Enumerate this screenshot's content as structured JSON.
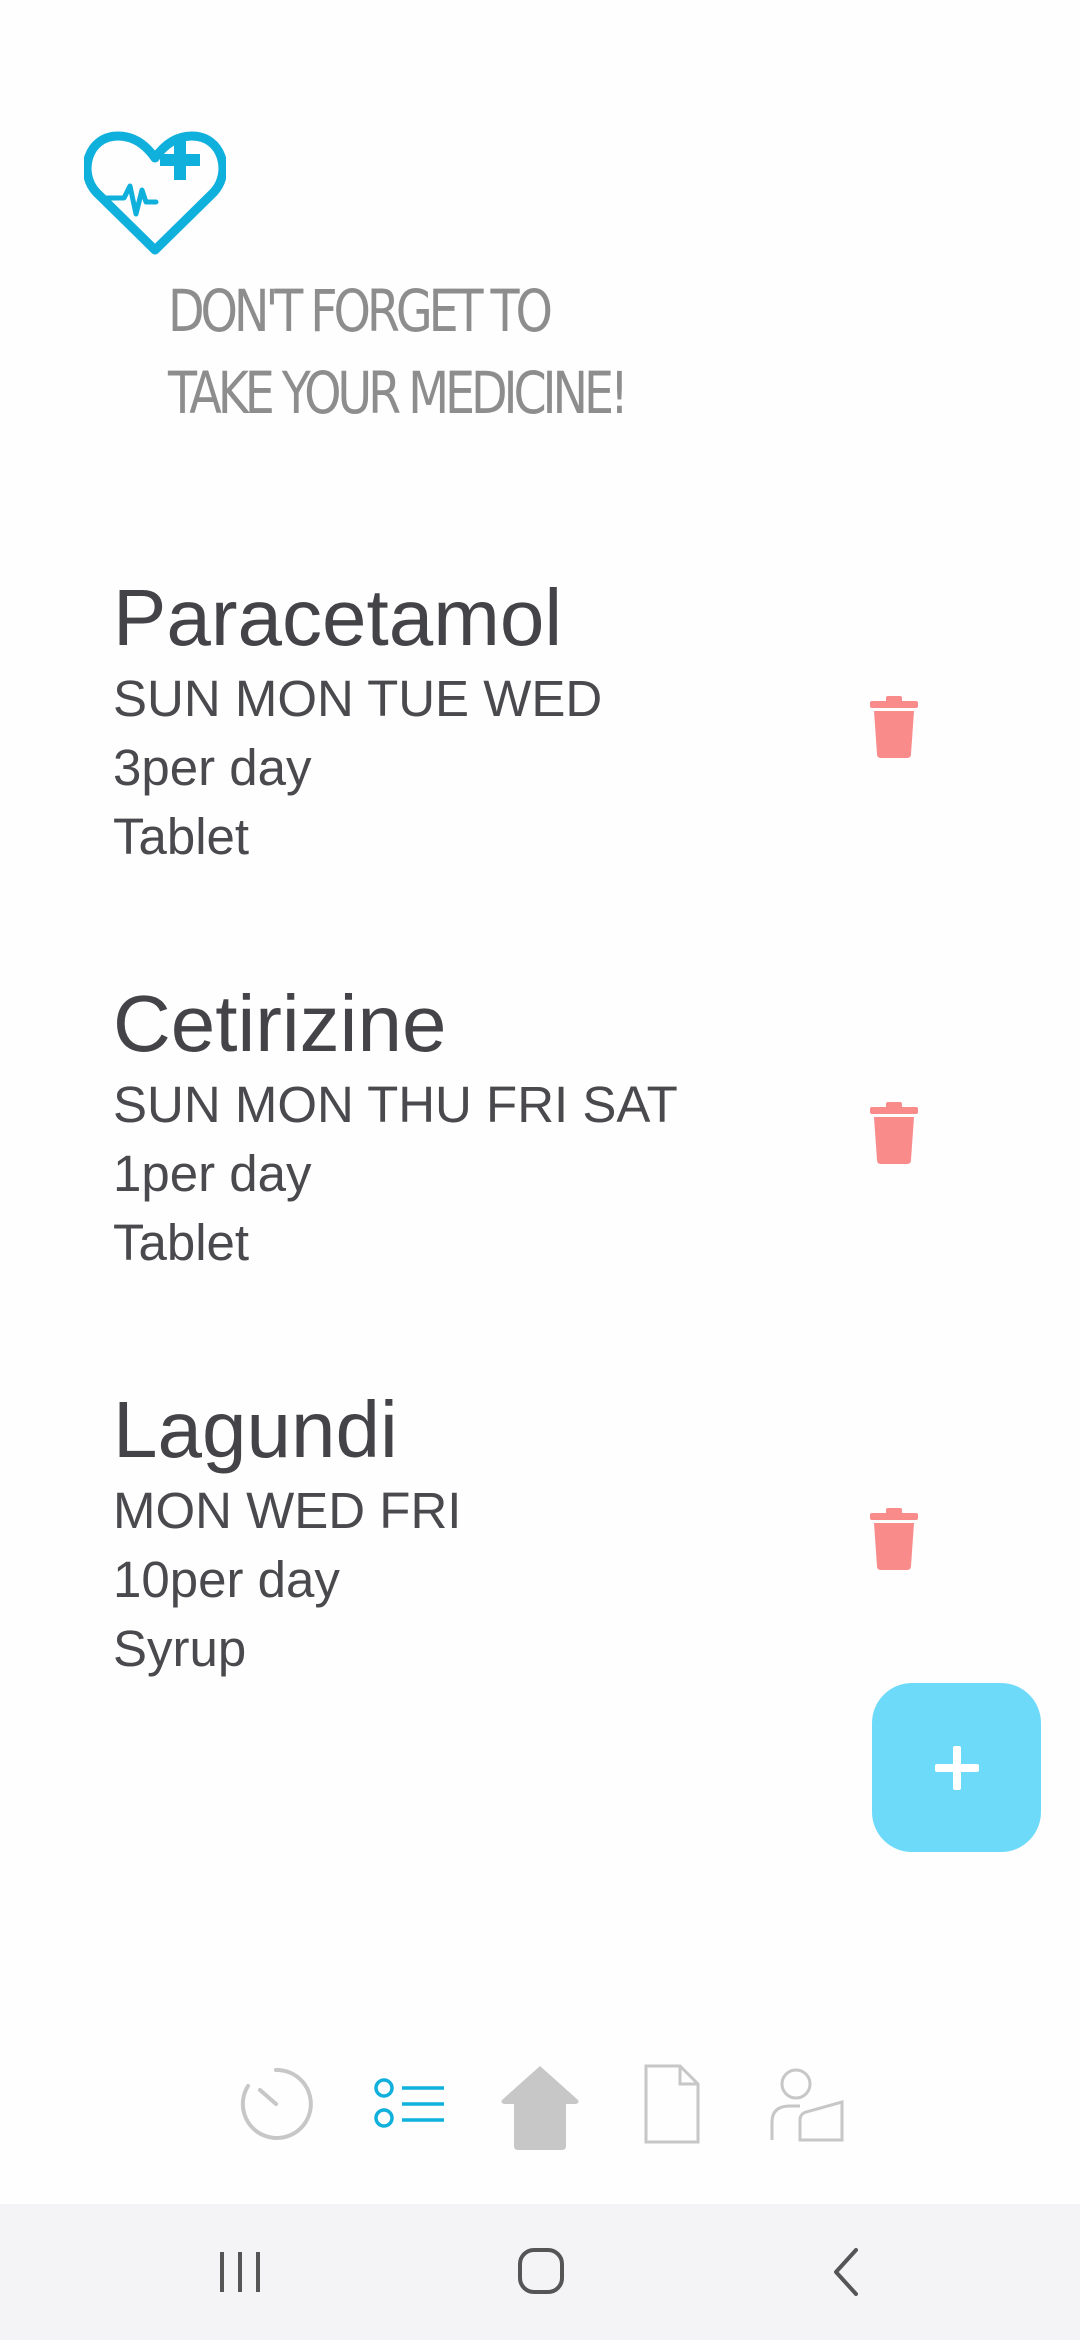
{
  "header": {
    "logo_icon": "heart-pulse-cross-icon",
    "headline_line1": "DON'T FORGET TO",
    "headline_line2": "TAKE YOUR MEDICINE!"
  },
  "medicines": [
    {
      "name": "Paracetamol",
      "days": "SUN MON TUE WED",
      "frequency": "3per day",
      "form": "Tablet"
    },
    {
      "name": "Cetirizine",
      "days": "SUN MON THU FRI SAT",
      "frequency": "1per day",
      "form": "Tablet"
    },
    {
      "name": "Lagundi",
      "days": "MON WED FRI",
      "frequency": "10per day",
      "form": "Syrup"
    }
  ],
  "fab": {
    "icon": "plus-icon"
  },
  "bottom_nav": {
    "items": [
      {
        "icon": "clock-icon",
        "active": false
      },
      {
        "icon": "list-icon",
        "active": true
      },
      {
        "icon": "home-icon",
        "active": false
      },
      {
        "icon": "document-icon",
        "active": false
      },
      {
        "icon": "profile-icon",
        "active": false
      }
    ]
  },
  "system_nav": [
    "recent-apps-icon",
    "home-circle-icon",
    "back-icon"
  ],
  "colors": {
    "accent": "#0fb0dc",
    "fab": "#6ddafa",
    "delete": "#f98b8b",
    "nav_inactive": "#c7c7c7",
    "text": "#444348",
    "headline": "#8d8d8d"
  }
}
